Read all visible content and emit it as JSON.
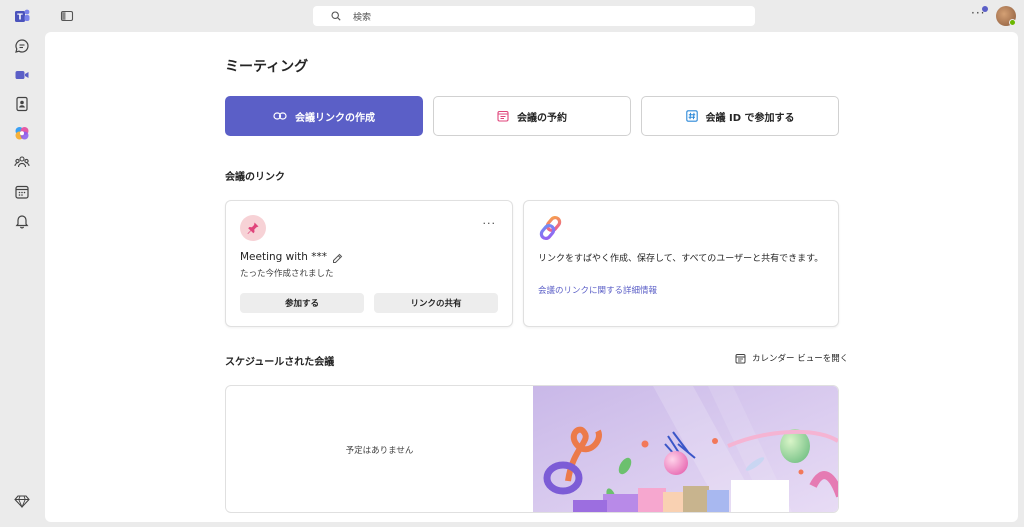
{
  "topbar": {
    "search_placeholder": "検索",
    "more_label": "···"
  },
  "rail": {
    "items": [
      "teams-logo",
      "chat",
      "meet",
      "contacts",
      "copilot",
      "communities",
      "calendar",
      "activity"
    ],
    "bottom": "premium"
  },
  "page": {
    "title": "ミーティング"
  },
  "actions": {
    "create_link": "会議リンクの作成",
    "schedule": "会議の予約",
    "join_by_id": "会議 ID で参加する"
  },
  "links_section": {
    "title": "会議のリンク",
    "meeting_card": {
      "name": "Meeting with ***",
      "subtitle": "たった今作成されました",
      "more": "···",
      "join_label": "参加する",
      "share_label": "リンクの共有"
    },
    "info_card": {
      "text": "リンクをすばやく作成、保存して、すべてのユーザーと共有できます。",
      "link": "会議のリンクに関する詳細情報"
    }
  },
  "scheduled_section": {
    "title": "スケジュールされた会議",
    "calendar_view_label": "カレンダー ビューを開く",
    "empty_text": "予定はありません"
  },
  "colors": {
    "accent": "#5b5fc7",
    "background": "#ebebeb",
    "panel": "#ffffff"
  }
}
